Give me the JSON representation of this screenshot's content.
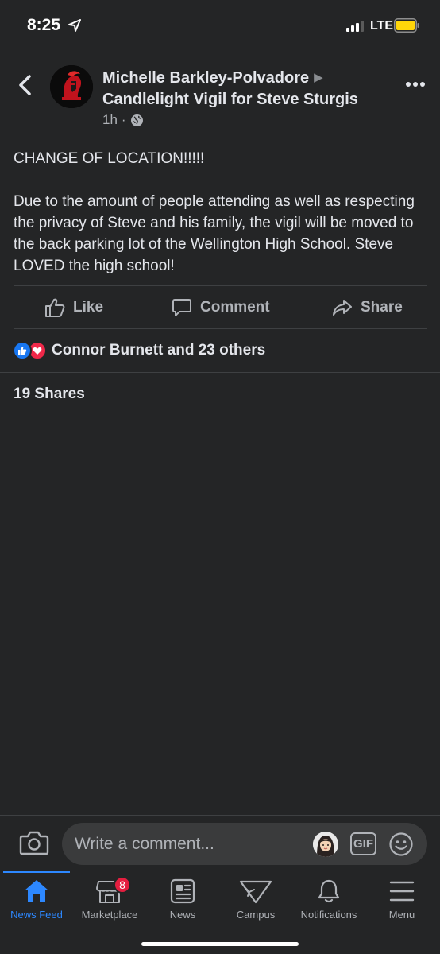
{
  "status_bar": {
    "time": "8:25",
    "network": "LTE"
  },
  "post": {
    "author": "Michelle Barkley-Polvadore",
    "group": "Candlelight Vigil for Steve Sturgis",
    "time_ago": "1h",
    "dot": "·",
    "arrow_glyph": "▶",
    "text": [
      "CHANGE OF LOCATION!!!!!",
      "Due to the amount of people attending as well as respecting the privacy of Steve and his family, the vigil will be moved to the back parking lot of the Wellington High School. Steve LOVED the high school!"
    ]
  },
  "actions": {
    "like": "Like",
    "comment": "Comment",
    "share": "Share"
  },
  "reactions": {
    "summary": "Connor Burnett and 23 others",
    "types": [
      "like",
      "love"
    ]
  },
  "shares": "19 Shares",
  "composer": {
    "placeholder": "Write a comment...",
    "gif_label": "GIF"
  },
  "tabbar": {
    "items": [
      {
        "label": "News Feed",
        "icon": "home-icon",
        "active": true
      },
      {
        "label": "Marketplace",
        "icon": "marketplace-icon",
        "badge": "8"
      },
      {
        "label": "News",
        "icon": "news-icon"
      },
      {
        "label": "Campus",
        "icon": "campus-icon"
      },
      {
        "label": "Notifications",
        "icon": "bell-icon"
      },
      {
        "label": "Menu",
        "icon": "menu-icon"
      }
    ]
  },
  "colors": {
    "background": "#242526",
    "accent": "#2d88ff",
    "like": "#1877f2",
    "love": "#f02849",
    "badge": "#e41e3f",
    "battery": "#ffd60a"
  }
}
